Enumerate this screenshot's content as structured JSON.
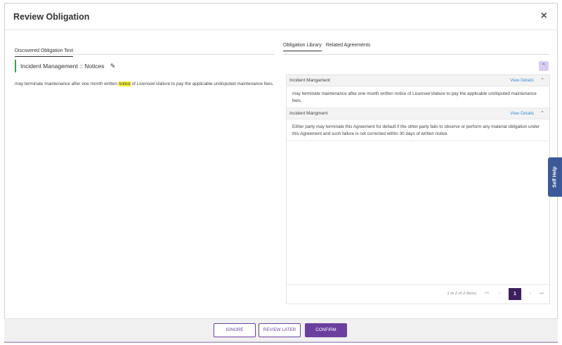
{
  "modal": {
    "title": "Review Obligation",
    "close_icon": "×"
  },
  "left": {
    "tab_label": "Discovered Obligation Text",
    "obligation_heading": "Incident Management :: Notices",
    "edit_icon": "pencil-icon",
    "text_before": "may terminate maintenance after one month written ",
    "text_highlight": "notice",
    "text_after": " of Licensee'sfailure to pay the applicable undisputed maintenance fees."
  },
  "right": {
    "tabs": [
      {
        "label": "Obligation Library",
        "active": true
      },
      {
        "label": "Related Agreements",
        "active": false
      }
    ],
    "collapse_icon": "double-chevron-up-icon",
    "cards": [
      {
        "title": "Incident Mangament",
        "view_details": "View Details",
        "body": "may terminate maintenance after one month written notice of Licensee'sfailure to pay the applicable undisputed maintenance fees."
      },
      {
        "title": "Incident Mangment",
        "view_details": "View Details",
        "body": "Either party may terminate this Agreement for default if the other party fails to observe or perform any material obligation under this Agreement and such failure is not corrected within 30 days of written notice."
      }
    ],
    "pager": {
      "summary": "1 to 2 of 2 Items",
      "current_page": "1"
    }
  },
  "self_help": {
    "label": "Self Help"
  },
  "footer": {
    "ignore_label": "IGNORE",
    "review_later_label": "REVIEW LATER",
    "confirm_label": "CONFIRM"
  },
  "colors": {
    "accent": "#6b3fa0",
    "pager_active": "#3d1f5f",
    "link": "#3a8dd6",
    "highlight": "#f4ee2b",
    "indicator": "#2eaa3a",
    "self_help": "#3b5998"
  }
}
